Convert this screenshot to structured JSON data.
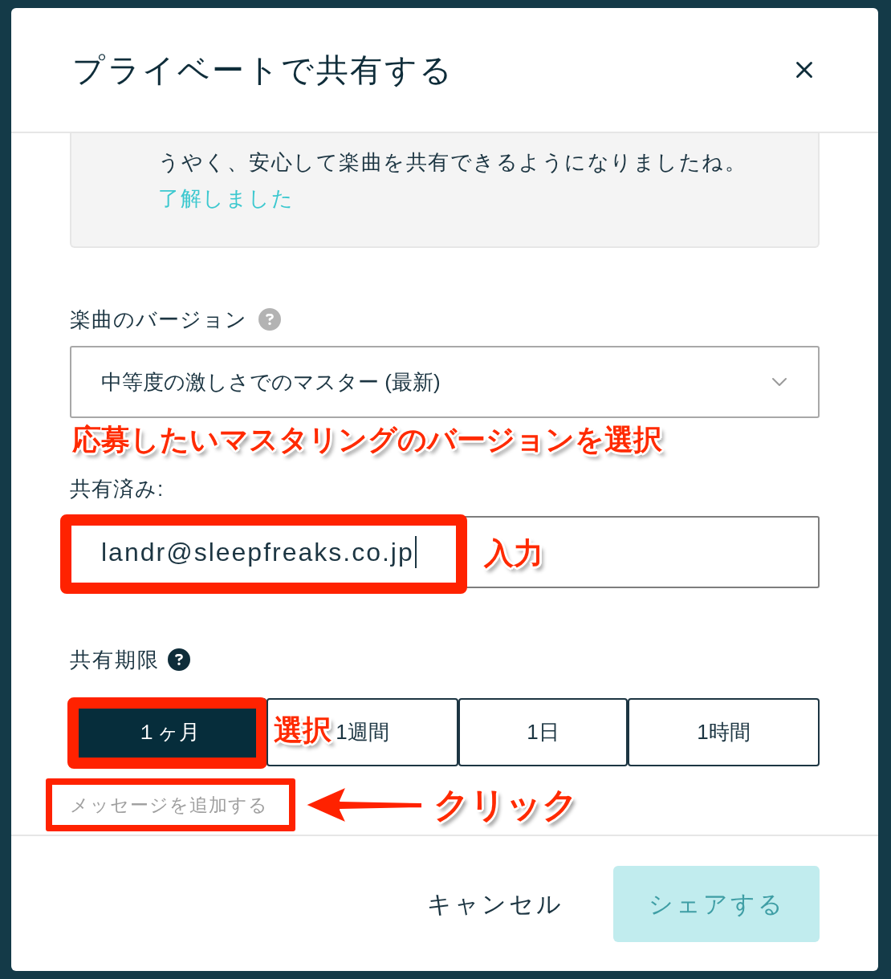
{
  "dialog": {
    "title": "プライベートで共有する"
  },
  "notice": {
    "text": "うやく、安心して楽曲を共有できるようになりましたね。",
    "link": "了解しました"
  },
  "version": {
    "label": "楽曲のバージョン",
    "value": "中等度の激しさでのマスター (最新)",
    "callout": "応募したいマスタリングのバージョンを選択"
  },
  "shared_with": {
    "label": "共有済み:",
    "value": "landr@sleepfreaks.co.jp",
    "highlighted": true,
    "callout": "入力"
  },
  "expiry": {
    "label": "共有期限",
    "callout": "選択",
    "options": [
      {
        "label": "１ヶ月",
        "selected": true,
        "highlighted": true
      },
      {
        "label": "1週間",
        "selected": false,
        "highlighted": false
      },
      {
        "label": "1日",
        "selected": false,
        "highlighted": false
      },
      {
        "label": "1時間",
        "selected": false,
        "highlighted": false
      }
    ]
  },
  "add_message": {
    "label": "メッセージを追加する",
    "highlighted": true,
    "arrow": true,
    "callout": "クリック"
  },
  "footer": {
    "cancel": "キャンセル",
    "share": {
      "label": "シェアする",
      "disabled": true
    }
  }
}
